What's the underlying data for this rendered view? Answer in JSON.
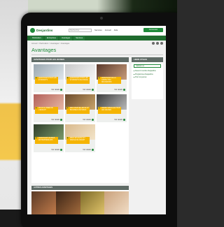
{
  "header": {
    "logo_text": "Desjardins",
    "search_placeholder": "Rechercher",
    "links": [
      "Services",
      "Accueil",
      "Aide"
    ],
    "cta_label": "Connexion"
  },
  "nav": {
    "items": [
      "Particuliers",
      "Entreprises",
      "Avantages",
      "Services"
    ]
  },
  "breadcrumb": "Accueil > Particuliers > Avantages > Avantages",
  "page_title": "Avantages",
  "main_section": {
    "heading": "AVANTAGES POUR LES JEUNES",
    "cards": [
      {
        "text": "AVANTAGES POUR LES ÉTUDIANTS",
        "more": "Voir détails"
      },
      {
        "text": "AVANTAGES POUR LES ÉTUDIANTS DE NIVEAU",
        "more": "Voir détails"
      },
      {
        "text": "AVANTAGES DE LA CARTE VISA DESJARDINS",
        "more": "Voir détails"
      },
      {
        "text": "POUR LE REÉE DE L'ENFANT",
        "more": "Voir détails"
      },
      {
        "text": "PRIX D'EXCELLENCE ET BOURSES D'ÉTUDES",
        "more": "Voir détails"
      },
      {
        "text": "OFFRE SPÉCIALE POUR LES JEUNES",
        "more": "Voir détails"
      },
      {
        "text": "AVANTAGES JEUNES ENTREPRENEURS",
        "more": "Voir détails"
      },
      {
        "text": "PRÊT ÉTUDIANT ET MARGE DE CRÉDIT",
        "more": "Voir détails"
      }
    ]
  },
  "sidebar": {
    "heading": "LIENS UTILES",
    "sub_label": "Calculer un",
    "items": [
      "Devenir membre Desjardins",
      "Programmes Desjardins",
      "Pour les jeunes"
    ]
  },
  "bottom_section": {
    "heading": "AUTRES AVANTAGES"
  },
  "colors": {
    "brand_green": "#1f8a3a",
    "accent_yellow": "#f5b400",
    "section_gray": "#5f6b66"
  }
}
